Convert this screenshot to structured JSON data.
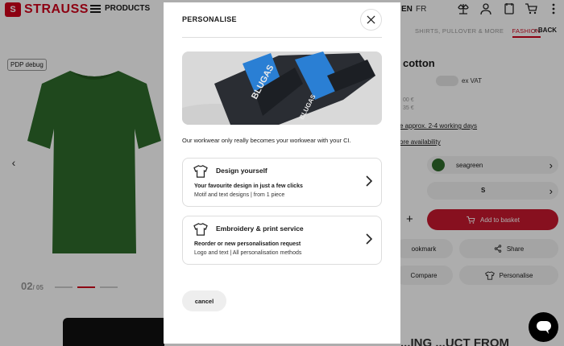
{
  "header": {
    "brand": "STRAUSS",
    "logo_mark": "S",
    "menu_label": "PRODUCTS",
    "lang_active": "EN",
    "lang_other": "FR",
    "icons": [
      "compare-scale-icon",
      "user-icon",
      "wishlist-icon",
      "basket-icon",
      "more-vertical-icon"
    ]
  },
  "breadcrumb": {
    "trail": "SHIRTS, PULLOVER & MORE",
    "current": "FASHION",
    "back_label": "BACK"
  },
  "product": {
    "debug_badge": "PDP debug",
    "title": "cotton",
    "price_toggle_label": "ex VAT",
    "price_line_1": "00 €",
    "price_line_2": "35 €",
    "shipping_link": "e approx. 2-4 working days",
    "availability_link": "ore availability",
    "color_value": "seagreen",
    "size_value": "S",
    "qty_plus": "+",
    "add_to_basket": "Add to basket",
    "bookmark_label": "ookmark",
    "share_label": "Share",
    "compare_label": "Compare",
    "personalise_label": "Personalise",
    "slide_current": "02",
    "slide_total": "/ 05",
    "shirt_color": "#2e6b2b"
  },
  "promo": {
    "banner_text": "...ING ...UCT FROM"
  },
  "modal": {
    "title": "PERSONALISE",
    "intro": "Our workwear only really becomes your workwear with your CI.",
    "hero_brand_text": "BLUGAS",
    "options": [
      {
        "title": "Design yourself",
        "subtitle": "Your favourite design in just a few clicks",
        "description": "Motif and text designs | from 1 piece"
      },
      {
        "title": "Embroidery & print service",
        "subtitle": "Reorder or new personalisation request",
        "description": "Logo and text | All personalisation methods"
      }
    ],
    "cancel_label": "cancel"
  },
  "colors": {
    "brand_red": "#d0021b",
    "basket_red": "#c8192e",
    "hero_blue": "#2a7fd4"
  }
}
